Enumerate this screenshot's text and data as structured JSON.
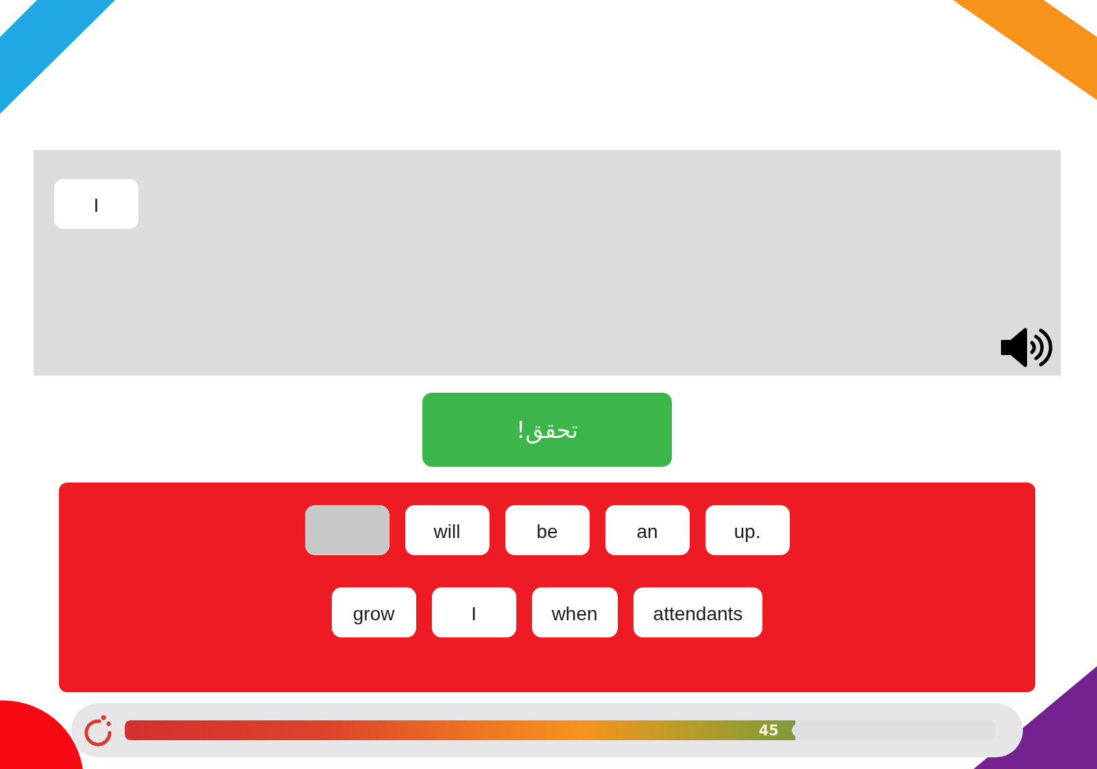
{
  "answer": {
    "placed_words": [
      "I"
    ]
  },
  "check_button": {
    "label": "تحقق!"
  },
  "word_bank": {
    "rows": [
      [
        {
          "used": true
        },
        {
          "word": "will",
          "used": false
        },
        {
          "word": "be",
          "used": false
        },
        {
          "word": "an",
          "used": false
        },
        {
          "word": "up.",
          "used": false
        }
      ],
      [
        {
          "word": "grow",
          "used": false
        },
        {
          "word": "I",
          "used": false
        },
        {
          "word": "when",
          "used": false
        },
        {
          "word": "attendants",
          "used": false
        }
      ]
    ]
  },
  "timer": {
    "reading": "45",
    "level": 0.77
  }
}
